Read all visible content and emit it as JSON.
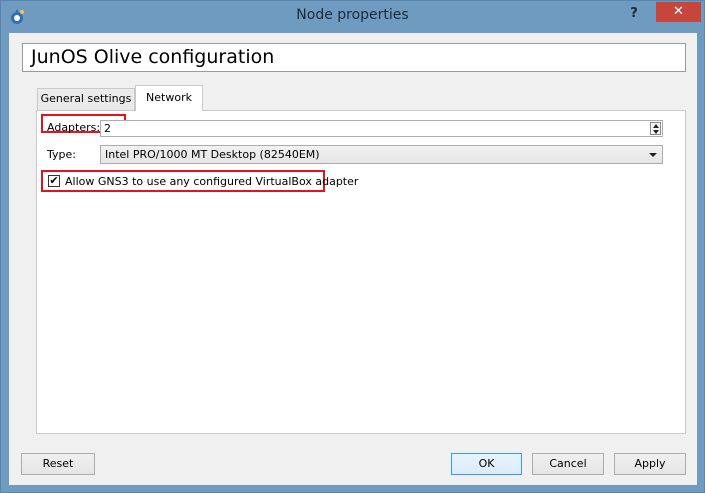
{
  "window": {
    "title": "Node properties",
    "help_label": "?",
    "close_label": "✕"
  },
  "header": {
    "title": "JunOS Olive configuration"
  },
  "tabs": [
    {
      "label": "General settings",
      "selected": false
    },
    {
      "label": "Network",
      "selected": true
    }
  ],
  "network": {
    "adapters_label": "Adapters:",
    "adapters_value": "2",
    "type_label": "Type:",
    "type_value": "Intel PRO/1000 MT Desktop (82540EM)",
    "allow_label": "Allow GNS3 to use any configured VirtualBox adapter",
    "allow_checked": true,
    "check_mark": "✔"
  },
  "buttons": {
    "reset": "Reset",
    "ok": "OK",
    "cancel": "Cancel",
    "apply": "Apply"
  },
  "colors": {
    "titlebar": "#6f9bc0",
    "close": "#c7463b",
    "highlight": "#e0141a"
  },
  "icons": {
    "app": "gns3-icon",
    "spin_up": "arrow-up-icon",
    "spin_down": "arrow-down-icon",
    "combo": "chevron-down-icon"
  }
}
